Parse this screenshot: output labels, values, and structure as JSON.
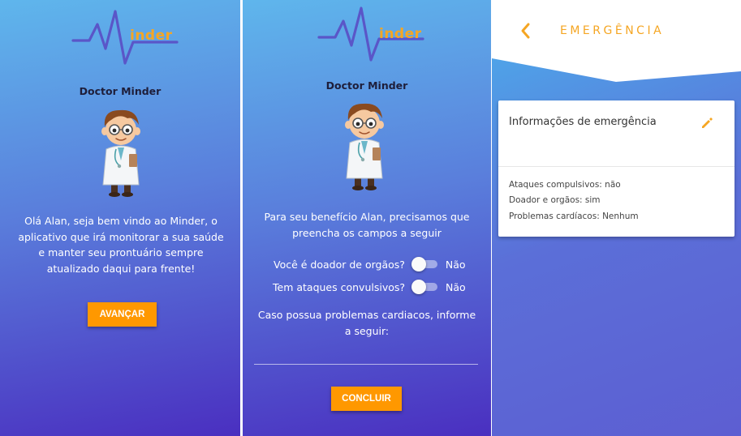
{
  "colors": {
    "accent": "#ff9800",
    "logo_text": "#f5a623",
    "gradient_top": "#5fb6ec",
    "gradient_bottom": "#4a2fc0"
  },
  "logo": {
    "text": "inder"
  },
  "screen_welcome": {
    "doctor_name": "Doctor Minder",
    "intro": "Olá Alan, seja bem vindo ao Minder, o aplicativo que irá monitorar a sua saúde e manter seu prontuário sempre atualizado daqui para frente!",
    "advance_button": "AVANÇAR"
  },
  "screen_form": {
    "doctor_name": "Doctor Minder",
    "intro": "Para seu benefício Alan, precisamos que preencha os campos a seguir",
    "donor_question": "Você é doador de orgãos?",
    "donor_value": "Não",
    "seizure_question": "Tem ataques convulsivos?",
    "seizure_value": "Não",
    "heart_prompt": "Caso possua problemas cardiacos, informe a seguir:",
    "heart_input_value": "",
    "finish_button": "CONCLUIR"
  },
  "screen_emergency": {
    "title": "EMERGÊNCIA",
    "back_icon": "chevron-left-icon",
    "card_title": "Informações de emergência",
    "edit_icon": "pencil-icon",
    "lines": [
      "Ataques compulsivos: não",
      "Doador e orgãos: sim",
      "Problemas cardíacos:  Nenhum"
    ]
  }
}
